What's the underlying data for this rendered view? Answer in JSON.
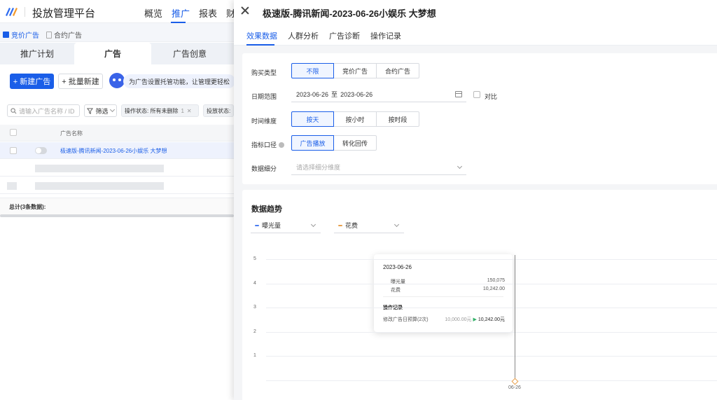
{
  "app": {
    "title": "投放管理平台",
    "nav": [
      "概览",
      "推广",
      "报表",
      "财"
    ],
    "nav_active": "推广",
    "accent": "#1a5ee8"
  },
  "subbar": {
    "items": [
      {
        "label": "竞价广告",
        "icon": "checkbox-icon"
      },
      {
        "label": "合约广告",
        "icon": "doc-icon"
      }
    ]
  },
  "main_tabs": [
    "推广计划",
    "广告",
    "广告创意"
  ],
  "toolbar": {
    "new_ad": "+ 新建广告",
    "batch_new": "+ 批量新建",
    "robot_tip": "为广告设置托管功能，让管理更轻松"
  },
  "filters": {
    "search_placeholder": "请输入广告名称 / ID",
    "filter_btn": "筛选",
    "tag1": "操作状态: 所有未删除",
    "tag1_count": "1",
    "tag2": "投放状态:"
  },
  "table": {
    "col_name": "广告名称",
    "rows": [
      {
        "name": "极速版-腾讯新闻-2023-06-26小娱乐 大梦想"
      }
    ],
    "totals": "总计(3条数据):"
  },
  "drawer": {
    "title": "极速版-腾讯新闻-2023-06-26小娱乐 大梦想",
    "tabs": [
      "效果数据",
      "人群分析",
      "广告诊断",
      "操作记录"
    ],
    "form": {
      "buy_type_label": "购买类型",
      "buy_type_options": [
        "不限",
        "竞价广告",
        "合约广告"
      ],
      "date_range_label": "日期范围",
      "date_start": "2023-06-26",
      "date_sep": "至",
      "date_end": "2023-06-26",
      "compare_label": "对比",
      "time_dim_label": "时间维度",
      "time_dim_options": [
        "按天",
        "按小时",
        "按时段"
      ],
      "metric_source_label": "指标口径",
      "metric_source_options": [
        "广告播放",
        "转化回传"
      ],
      "breakdown_label": "数据细分",
      "breakdown_placeholder": "请选择细分维度"
    },
    "trend": {
      "title": "数据趋势",
      "metric1": "曝光量",
      "metric1_color": "#4a7cf0",
      "metric2": "花费",
      "metric2_color": "#e8a04c"
    }
  },
  "chart_data": {
    "type": "line",
    "title": "",
    "x": [
      "06-26"
    ],
    "yticks": [
      "1",
      "2",
      "3",
      "4",
      "5"
    ],
    "series": [
      {
        "name": "曝光量",
        "values": [
          150075
        ]
      },
      {
        "name": "花费",
        "values": [
          10242.0
        ]
      }
    ]
  },
  "tooltip": {
    "date": "2023-06-26",
    "rows": [
      {
        "label": "曝光量",
        "value": "150,075"
      },
      {
        "label": "花费",
        "value": "10,242.00"
      }
    ],
    "section": "操作记录",
    "record": {
      "action": "修改广告日预算(2次)",
      "old": "10,000.00元",
      "arrow": "▶",
      "new": "10,242.00元"
    }
  }
}
